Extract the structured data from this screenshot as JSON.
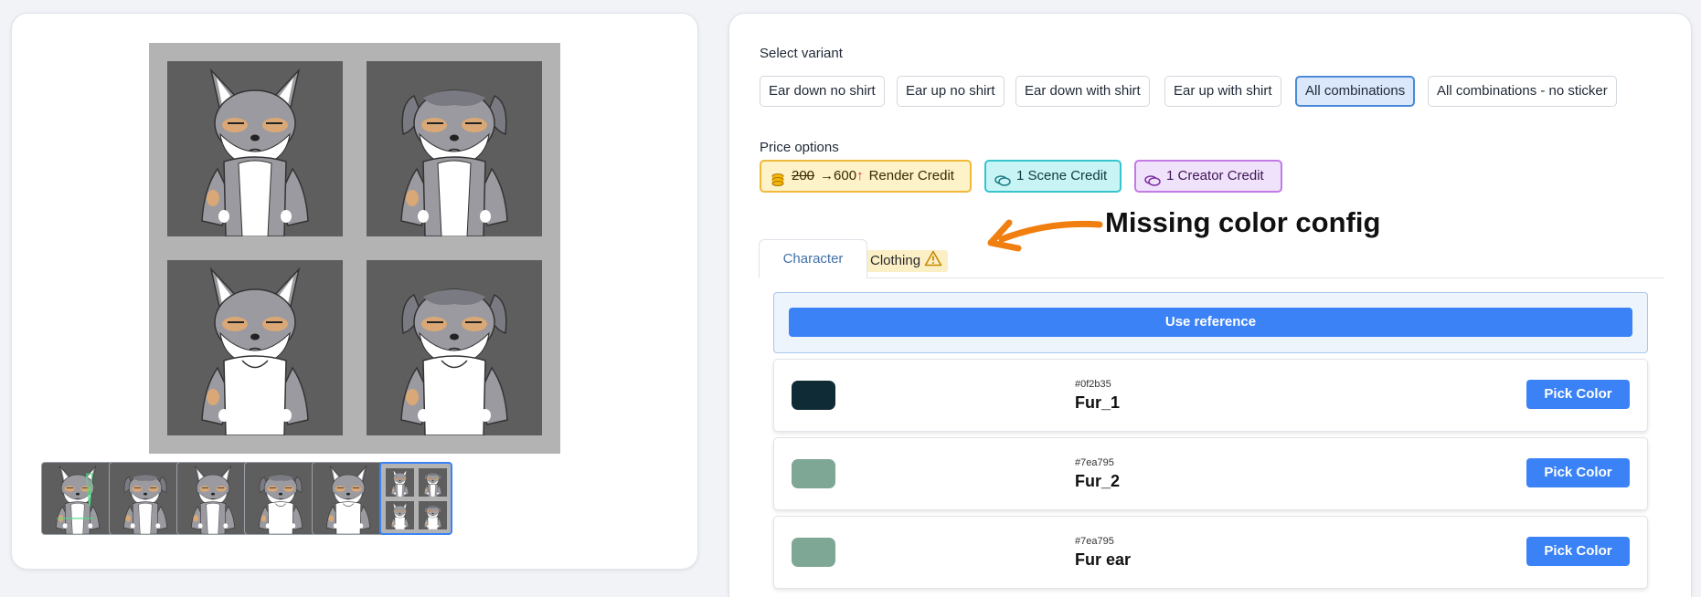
{
  "variant_section": {
    "label": "Select variant",
    "options": [
      {
        "label": "Ear down no shirt",
        "active": false
      },
      {
        "label": "Ear up no shirt",
        "active": false
      },
      {
        "label": "Ear down with shirt",
        "active": false
      },
      {
        "label": "Ear up with shirt",
        "active": false
      },
      {
        "label": "All combinations",
        "active": true
      },
      {
        "label": "All combinations - no sticker",
        "active": false
      }
    ]
  },
  "price_section": {
    "label": "Price options",
    "render": {
      "old_price": "200",
      "arrow": "→",
      "new_price": "600",
      "up_arrow": "↑",
      "label": "Render Credit"
    },
    "scene": {
      "label": "1 Scene Credit"
    },
    "creator": {
      "label": "1 Creator Credit"
    }
  },
  "annotation": {
    "text": "Missing color config",
    "color": "#f07f0f"
  },
  "tabs": {
    "character": "Character",
    "clothing": "Clothing",
    "warning_icon": "warning-triangle-icon"
  },
  "reference": {
    "button_label": "Use reference"
  },
  "colors": [
    {
      "hex": "#0f2b35",
      "name": "Fur_1",
      "button": "Pick Color"
    },
    {
      "hex": "#7ea795",
      "name": "Fur_2",
      "button": "Pick Color"
    },
    {
      "hex": "#7ea795",
      "name": "Fur ear",
      "button": "Pick Color"
    }
  ],
  "accent": "#3b82f6"
}
